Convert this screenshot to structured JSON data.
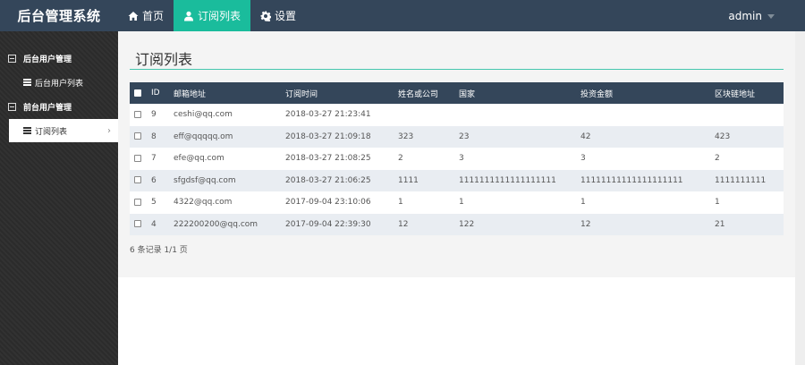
{
  "brand": "后台管理系统",
  "nav": {
    "home": "首页",
    "subscriptions": "订阅列表",
    "settings": "设置",
    "user": "admin"
  },
  "sidebar": {
    "groups": [
      {
        "label": "后台用户管理",
        "items": [
          "后台用户列表"
        ]
      },
      {
        "label": "前台用户管理",
        "items": [
          "订阅列表"
        ]
      }
    ]
  },
  "main": {
    "title": "订阅列表",
    "columns": [
      "ID",
      "邮箱地址",
      "订阅时间",
      "姓名或公司",
      "国家",
      "投资金额",
      "区块链地址"
    ],
    "rows": [
      [
        "9",
        "ceshi@qq.com",
        "2018-03-27 21:23:41",
        "",
        "",
        "",
        ""
      ],
      [
        "8",
        "eff@qqqqq.om",
        "2018-03-27 21:09:18",
        "323",
        "23",
        "42",
        "423"
      ],
      [
        "7",
        "efe@qq.com",
        "2018-03-27 21:08:25",
        "2",
        "3",
        "3",
        "2"
      ],
      [
        "6",
        "sfgdsf@qq.com",
        "2018-03-27 21:06:25",
        "1111",
        "1111111111111111111",
        "11111111111111111111",
        "1111111111"
      ],
      [
        "5",
        "4322@qq.com",
        "2017-09-04 23:10:06",
        "1",
        "1",
        "1",
        "1"
      ],
      [
        "4",
        "222200200@qq.com",
        "2017-09-04 22:39:30",
        "12",
        "122",
        "12",
        "21"
      ]
    ],
    "summary": "6 条记录 1/1 页"
  }
}
